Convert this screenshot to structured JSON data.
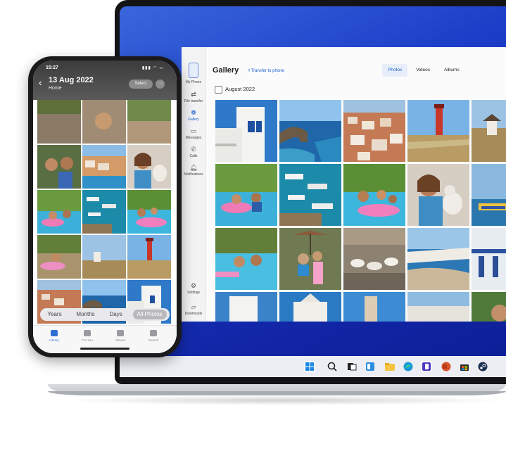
{
  "app": {
    "title": "Gallery",
    "transfer_label": "Transfer to phone",
    "tabs": [
      {
        "label": "Photos",
        "active": true
      },
      {
        "label": "Videos",
        "active": false
      },
      {
        "label": "Albums",
        "active": false
      }
    ],
    "date_section": "August 2022",
    "nav": {
      "items": [
        {
          "label": "My Phone",
          "icon": "phone-icon"
        },
        {
          "label": "File transfer",
          "icon": "transfer-icon"
        },
        {
          "label": "Gallery",
          "icon": "gallery-icon",
          "active": true
        },
        {
          "label": "Messages",
          "icon": "messages-icon"
        },
        {
          "label": "Calls",
          "icon": "calls-icon"
        },
        {
          "label": "Notifications",
          "icon": "bell-icon"
        }
      ],
      "bottom_items": [
        {
          "label": "Settings",
          "icon": "gear-icon"
        },
        {
          "label": "Downloads",
          "icon": "downloads-icon"
        }
      ]
    }
  },
  "phone": {
    "time": "15:27",
    "date_title": "13 Aug 2022",
    "subtitle": "Home",
    "select_label": "Select",
    "more_label": "···",
    "segments": [
      {
        "label": "Years",
        "active": false
      },
      {
        "label": "Months",
        "active": false
      },
      {
        "label": "Days",
        "active": false
      },
      {
        "label": "All Photos",
        "active": true
      }
    ],
    "tabbar": [
      {
        "label": "Library",
        "active": true
      },
      {
        "label": "For You",
        "active": false
      },
      {
        "label": "Albums",
        "active": false
      },
      {
        "label": "Search",
        "active": false
      }
    ]
  },
  "taskbar": {
    "icons": [
      "windows-start-icon",
      "search-icon",
      "task-view-icon",
      "widgets-icon",
      "file-explorer-icon",
      "edge-icon",
      "phone-link-icon",
      "powerpoint-icon",
      "store-icon",
      "steam-icon"
    ]
  },
  "colors": {
    "accent": "#1a5fd0",
    "wallpaper": "#1c3ec8"
  }
}
